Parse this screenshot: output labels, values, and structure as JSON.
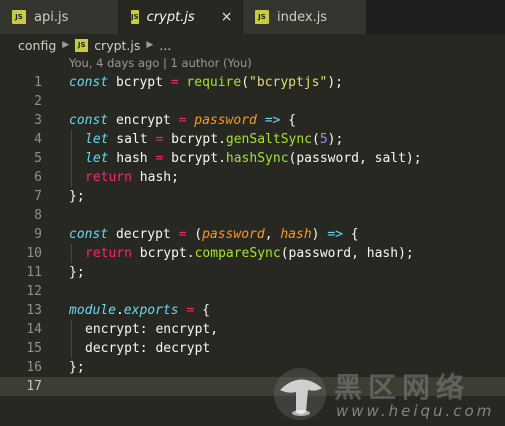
{
  "tabs": [
    {
      "label": "api.js",
      "badge": "JS",
      "italic": false,
      "active": false
    },
    {
      "label": "crypt.js",
      "badge": "JS",
      "italic": true,
      "active": true,
      "close": "×"
    },
    {
      "label": "index.js",
      "badge": "JS",
      "italic": false,
      "active": false
    }
  ],
  "breadcrumb": {
    "folder": "config",
    "file": "crypt.js",
    "more": "...",
    "badge": "JS"
  },
  "codelens": "You, 4 days ago | 1 author (You)",
  "line_numbers": [
    "1",
    "2",
    "3",
    "4",
    "5",
    "6",
    "7",
    "8",
    "9",
    "10",
    "11",
    "12",
    "13",
    "14",
    "15",
    "16",
    "17"
  ],
  "code": {
    "l1": {
      "kw": "const",
      "name": " bcrypt ",
      "op": "=",
      "fn": " require",
      "open": "(",
      "str": "\"bcryptjs\"",
      "close": ");"
    },
    "l3": {
      "kw": "const",
      "name": " encrypt ",
      "op": "=",
      "param": " password ",
      "arrow": "=>",
      "brace": " {"
    },
    "l4": {
      "kw": "let",
      "name": " salt ",
      "op": "=",
      "obj": " bcrypt.",
      "fn": "genSaltSync",
      "open": "(",
      "num": "5",
      "close": ");"
    },
    "l5": {
      "kw": "let",
      "name": " hash ",
      "op": "=",
      "obj": " bcrypt.",
      "fn": "hashSync",
      "args": "(password, salt);"
    },
    "l6": {
      "kw": "return",
      "rest": " hash;"
    },
    "l7": {
      "text": "};"
    },
    "l9": {
      "kw": "const",
      "name": " decrypt ",
      "op": "=",
      "open": " (",
      "p1": "password",
      "comma": ", ",
      "p2": "hash",
      "close": ") ",
      "arrow": "=>",
      "brace": " {"
    },
    "l10": {
      "kw": "return",
      "obj": " bcrypt.",
      "fn": "compareSync",
      "args": "(password, hash);"
    },
    "l11": {
      "text": "};"
    },
    "l13": {
      "mod": "module",
      "dot": ".",
      "exp": "exports",
      "op": " =",
      "brace": " {"
    },
    "l14": {
      "text": "encrypt: encrypt,"
    },
    "l15": {
      "text": "decrypt: decrypt"
    },
    "l16": {
      "text": "};"
    }
  },
  "watermark": {
    "title": "黑区网络",
    "url": "www.heiqu.com"
  },
  "colors": {
    "editor_bg": "#272822",
    "current_line": "#3e3d32",
    "keyword": "#66d9ef",
    "operator": "#f92672",
    "function": "#a6e22e",
    "string": "#e6db74",
    "number": "#ae81ff",
    "parameter": "#fd971f",
    "js_badge": "#cbcb41"
  }
}
